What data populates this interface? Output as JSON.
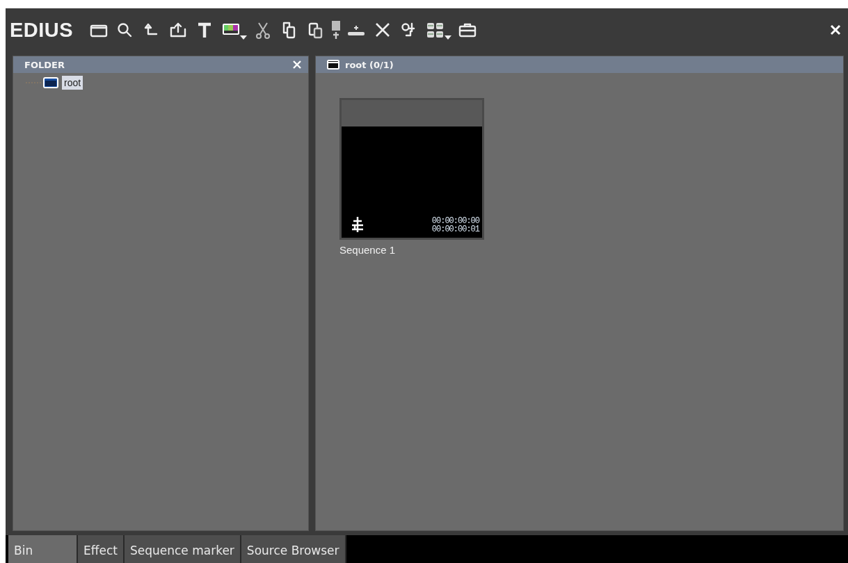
{
  "window": {
    "title": "EDIUS"
  },
  "toolbar": [
    {
      "kind": "folder"
    },
    {
      "kind": "search"
    },
    {
      "kind": "up"
    },
    {
      "kind": "export"
    },
    {
      "kind": "text"
    },
    {
      "kind": "colorbars",
      "dropdown": true
    },
    {
      "kind": "cut"
    },
    {
      "kind": "copy"
    },
    {
      "kind": "paste"
    },
    {
      "kind": "marker"
    },
    {
      "kind": "insert"
    },
    {
      "kind": "delete"
    },
    {
      "kind": "properties"
    },
    {
      "kind": "view",
      "dropdown": true
    },
    {
      "kind": "toolbox"
    }
  ],
  "folder_panel": {
    "title": "FOLDER",
    "tree": [
      {
        "label": "root",
        "selected": true
      }
    ]
  },
  "bin_panel": {
    "title": "root (0/1)",
    "clips": [
      {
        "name": "Sequence 1",
        "kind": "sequence",
        "timecode_in": "00:00:00:00",
        "timecode_out": "00:00:00:01"
      }
    ]
  },
  "tabs": [
    {
      "label": "Bin",
      "selected": true
    },
    {
      "label": "Effect",
      "selected": false
    },
    {
      "label": "Sequence marker",
      "selected": false
    },
    {
      "label": "Source Browser",
      "selected": false
    }
  ]
}
